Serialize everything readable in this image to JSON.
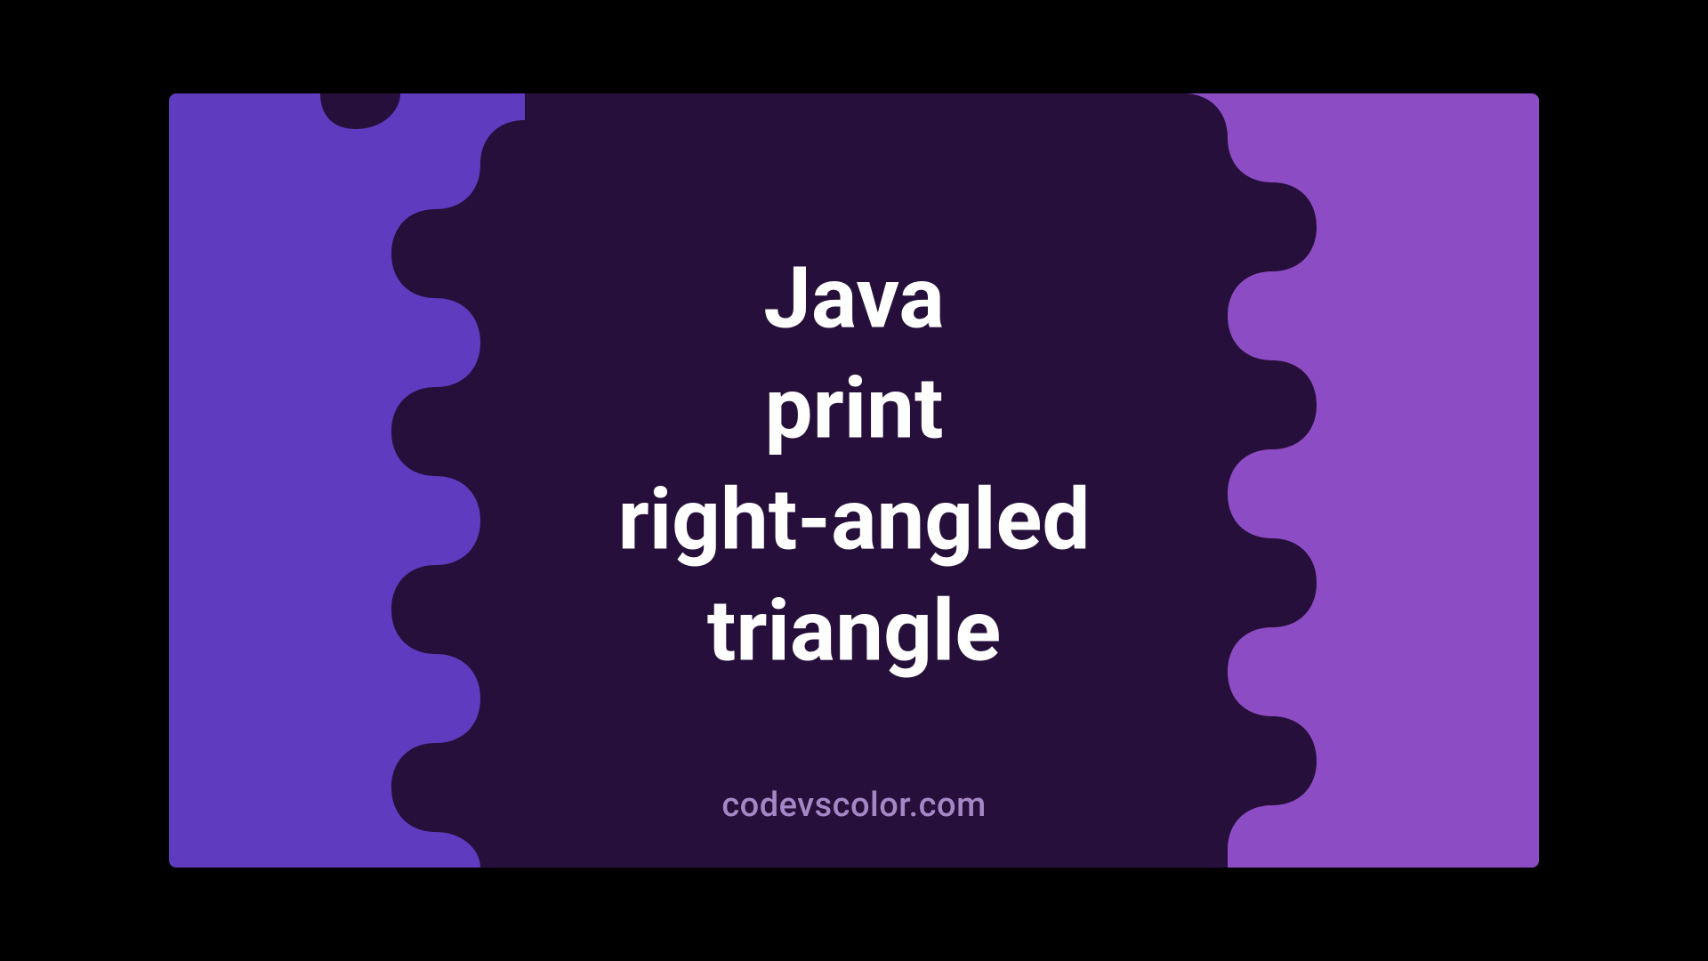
{
  "title": "Java\nprint\nright-angled\ntriangle",
  "watermark": "codevscolor.com",
  "colors": {
    "left_bg": "#5e3bbf",
    "right_bg": "#8c4cc3",
    "blob": "#260f3a",
    "text": "#ffffff",
    "watermark": "#a587c5"
  }
}
